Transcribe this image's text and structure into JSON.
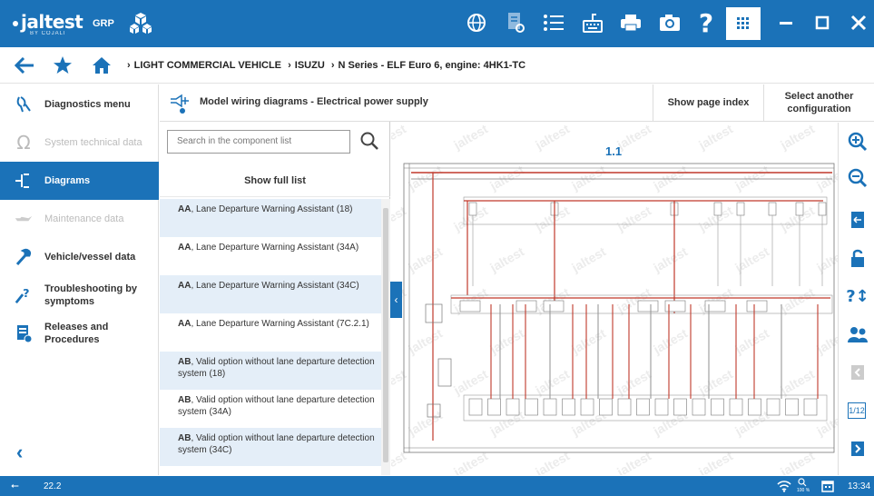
{
  "app": {
    "logo": "jaltest",
    "logo_sub": "BY COJALI",
    "module": "GRP"
  },
  "colors": {
    "primary": "#1b72b8",
    "wire_red": "#c0392b",
    "accent_light": "#e4eef8"
  },
  "toolbar_icons": [
    "globe-icon",
    "document-icon",
    "list-icon",
    "keyboard-icon",
    "printer-icon",
    "camera-icon",
    "help-icon",
    "grid-icon",
    "minimize-icon",
    "maximize-icon",
    "close-icon"
  ],
  "breadcrumb": {
    "items": [
      "LIGHT COMMERCIAL VEHICLE",
      "ISUZU",
      "N Series - ELF Euro 6, engine: 4HK1-TC"
    ]
  },
  "sidebar": {
    "items": [
      {
        "label": "Diagnostics menu",
        "icon": "diagnostics-icon",
        "state": "normal"
      },
      {
        "label": "System technical data",
        "icon": "omega-icon",
        "state": "disabled"
      },
      {
        "label": "Diagrams",
        "icon": "diagram-icon",
        "state": "active"
      },
      {
        "label": "Maintenance data",
        "icon": "oil-can-icon",
        "state": "disabled"
      },
      {
        "label": "Vehicle/vessel data",
        "icon": "wrench-icon",
        "state": "normal"
      },
      {
        "label": "Troubleshooting by symptoms",
        "icon": "troubleshoot-icon",
        "state": "normal"
      },
      {
        "label": "Releases and Procedures",
        "icon": "book-icon",
        "state": "normal"
      }
    ]
  },
  "header": {
    "title": "Model wiring diagrams - Electrical power supply",
    "show_index": "Show page index",
    "select_config": "Select another configuration"
  },
  "component_panel": {
    "search_placeholder": "Search in the component list",
    "show_full": "Show full list",
    "items": [
      {
        "code": "AA",
        "text": ", Lane Departure Warning Assistant (18)"
      },
      {
        "code": "AA",
        "text": ", Lane Departure Warning Assistant (34A)"
      },
      {
        "code": "AA",
        "text": ", Lane Departure Warning Assistant (34C)"
      },
      {
        "code": "AA",
        "text": ", Lane Departure Warning Assistant (7C.2.1)"
      },
      {
        "code": "AB",
        "text": ", Valid option without lane departure detection system (18)"
      },
      {
        "code": "AB",
        "text": ", Valid option without lane departure detection system (34A)"
      },
      {
        "code": "AB",
        "text": ", Valid option without lane departure detection system (34C)"
      }
    ]
  },
  "diagram": {
    "page_label": "1.1",
    "watermark": "jaltest"
  },
  "right_tools": {
    "page_indicator": "1/12"
  },
  "status": {
    "version": "22.2",
    "time": "13:34",
    "zoom": "100 %"
  }
}
